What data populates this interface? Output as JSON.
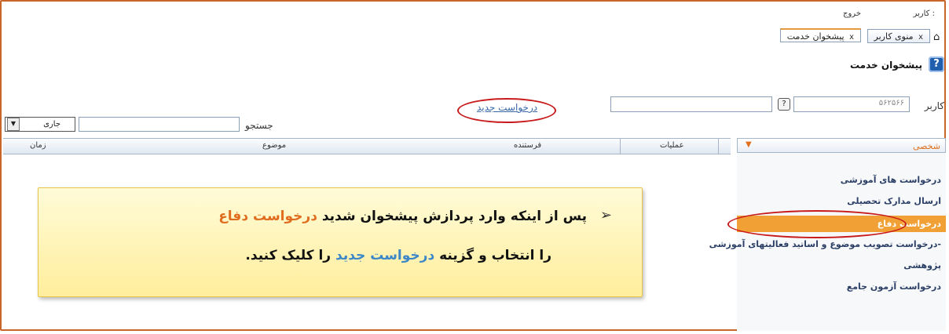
{
  "header": {
    "user_label": "کاربر :",
    "logout_label": "خروج",
    "tabs": [
      {
        "label": "منوی کاربر",
        "close": "x"
      },
      {
        "label": "پیشخوان خدمت",
        "close": "x"
      }
    ],
    "help_glyph": "?",
    "page_title": "پیشخوان خدمت"
  },
  "filters": {
    "user_label": "کاربر",
    "user_code": "۵۶۲۵۶۶",
    "lookup_label": "?",
    "new_request_link": "درخواست جدید",
    "search_label": "جستجو",
    "status_value": "جاری",
    "status_arrow": "▼"
  },
  "grid": {
    "columns": [
      "عملیات",
      "فرستنده",
      "موضوع",
      "زمان"
    ]
  },
  "sidebar": {
    "header": "شخصی",
    "chevron": "▼",
    "items": [
      {
        "label": "درخواست های آموزشی"
      },
      {
        "label": "ارسال مدارک تحصیلی"
      },
      {
        "label": "درخواست دفاع"
      },
      {
        "label": "درخواست تصویب موضوع و اساتید فعالیتهای آموزشی-"
      },
      {
        "label": "پژوهشی"
      },
      {
        "label": "درخواست آزمون جامع"
      }
    ],
    "active_index": 2
  },
  "callout": {
    "bullet": "➢",
    "line1_part1": "پس از اینکه وارد پردازش پیشخوان شدید",
    "line1_highlight": "درخواست دفاع",
    "line2_part1": "را انتخاب و گزینه",
    "line2_highlight": "درخواست جدید",
    "line2_part2": "را کلیک کنید."
  },
  "colors": {
    "frame": "#c8662a",
    "highlight_orange": "#e06d1f",
    "highlight_blue": "#3b87c8",
    "annotation_red": "#c8191b",
    "active_item": "#f0a034"
  }
}
